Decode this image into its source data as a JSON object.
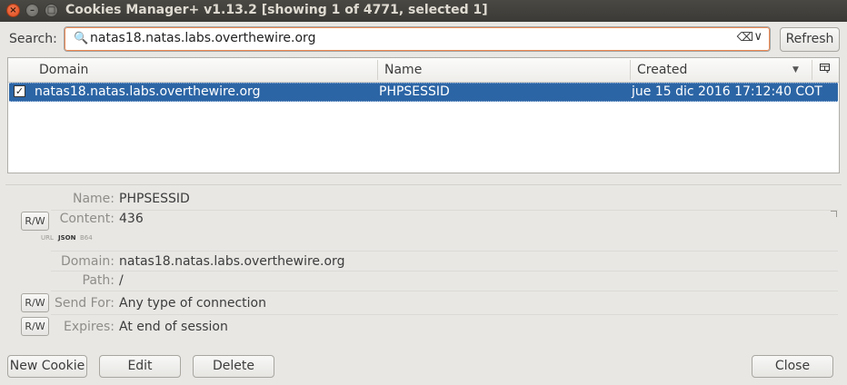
{
  "window": {
    "title": "Cookies Manager+ v1.13.2 [showing 1 of 4771, selected 1]",
    "controls": {
      "close": "×",
      "minimize": "–",
      "maximize": "□"
    }
  },
  "search": {
    "label": "Search:",
    "value": "natas18.natas.labs.overthewire.org",
    "icons": {
      "search": "🔍",
      "clear": "⌫",
      "dropdown": "∨"
    }
  },
  "refresh_label": "Refresh",
  "table": {
    "columns": [
      "Domain",
      "Name",
      "Created"
    ],
    "sort_indicator": "▼",
    "rows": [
      {
        "selected": true,
        "check": "✓",
        "domain": "natas18.natas.labs.overthewire.org",
        "name": "PHPSESSID",
        "created": "jue 15 dic 2016 17:12:40 COT"
      }
    ]
  },
  "details": {
    "rw_label": "R/W",
    "name_label": "Name:",
    "name_value": "PHPSESSID",
    "content_label": "Content:",
    "content_value": "436",
    "content_formats": [
      "URL",
      "JSON",
      "B64"
    ],
    "content_format_selected": "JSON",
    "domain_label": "Domain:",
    "domain_value": "natas18.natas.labs.overthewire.org",
    "path_label": "Path:",
    "path_value": "/",
    "sendfor_label": "Send For:",
    "sendfor_value": "Any type of connection",
    "expires_label": "Expires:",
    "expires_value": "At end of session"
  },
  "buttons": {
    "new_cookie": "New Cookie",
    "edit": "Edit",
    "delete": "Delete",
    "close": "Close"
  },
  "colors": {
    "selection": "#2c65a5",
    "titlebar": "#3c3b37",
    "close_button": "#e95420"
  }
}
